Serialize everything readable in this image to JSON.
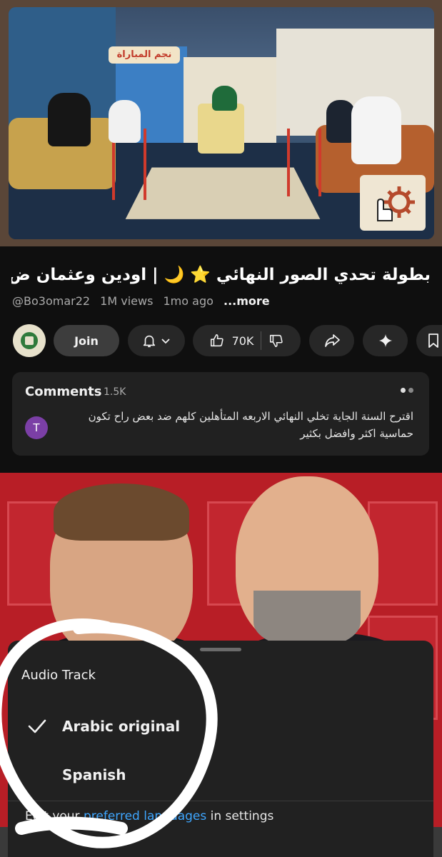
{
  "player": {
    "banner_text": "نجم المباراة"
  },
  "video": {
    "title": "بطولة تحدي الصور النهائي ⭐ 🌙 | اودين وعثمان ض...",
    "channel_handle": "@Bo3omar22",
    "views": "1M views",
    "age": "1mo ago",
    "more_label": "...more"
  },
  "actions": {
    "join_label": "Join",
    "like_count": "70K"
  },
  "comments": {
    "header": "Comments",
    "count": "1.5K",
    "avatar_letter": "T",
    "top_comment": "اقترح السنة الجاية تخلي النهائي  الاربعه المتأهلين كلهم ضد بعض راح تكون حماسية اكثر وافضل بكثير"
  },
  "audio_sheet": {
    "title": "Audio Track",
    "options": [
      {
        "label": "Arabic original",
        "selected": true
      },
      {
        "label": "Spanish",
        "selected": false
      }
    ],
    "footer_prefix": "Edit your ",
    "footer_link": "preferred languages",
    "footer_suffix": " in settings"
  },
  "colors": {
    "background": "#0f0f0f",
    "pill": "#272727",
    "sheet": "#212121",
    "link": "#3ea6ff",
    "comment_avatar": "#7b3fa6",
    "thumbnail_red": "#b81e26"
  },
  "icons": [
    "bell-icon",
    "chevron-down-icon",
    "thumbs-up-icon",
    "thumbs-down-icon",
    "share-icon",
    "sparkle-icon",
    "bookmark-icon",
    "checkmark-icon",
    "gear-icon",
    "pointer-hand-icon"
  ]
}
